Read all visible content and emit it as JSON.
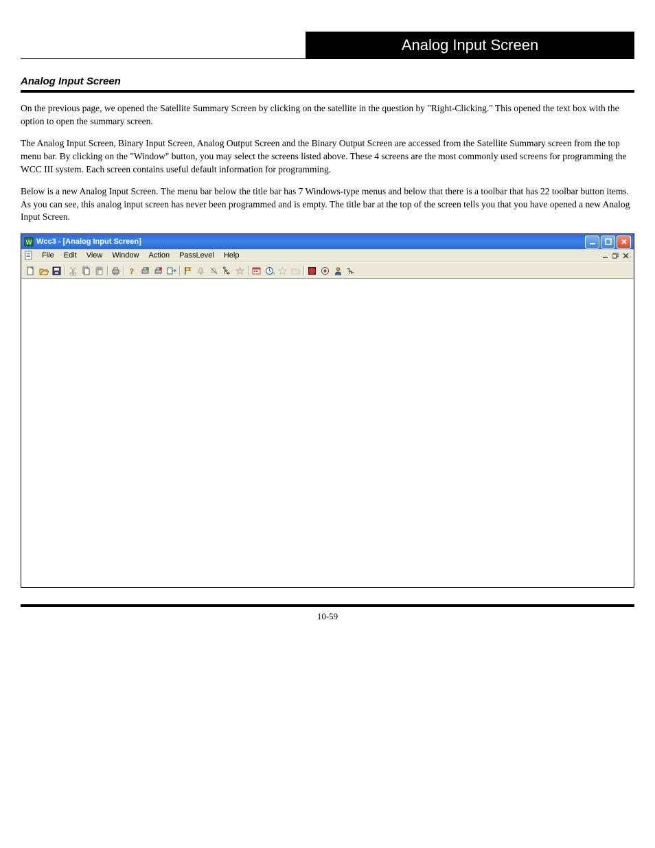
{
  "header": {
    "black_label": "Analog Input Screen"
  },
  "section_title": "Analog Input Screen",
  "paragraphs": {
    "p1": "On the previous page, we opened the Satellite Summary Screen by clicking on the satellite in the question by \"Right-Clicking.\" This opened the text box with the option to open the summary screen.",
    "p2": "The Analog Input Screen, Binary Input Screen, Analog Output Screen and the Binary Output Screen are accessed from the Satellite Summary screen from the top menu bar. By clicking on the \"Window\" button, you may select the screens listed above. These 4 screens are the most commonly used screens for programming the WCC III system. Each screen contains useful default information for programming.",
    "p3": "Below is a new Analog Input Screen. The menu bar below the title bar has 7 Windows-type menus and below that there is a toolbar that has 22 toolbar button items. As you can see, this analog input screen has never been programmed and is empty. The title bar at the top of the screen tells you that you have opened a new Analog Input Screen."
  },
  "window": {
    "title": "Wcc3 - [Analog Input Screen]",
    "buttons": {
      "min": "_",
      "max": "❐",
      "close": "✕"
    },
    "menu": [
      "File",
      "Edit",
      "View",
      "Window",
      "Action",
      "PassLevel",
      "Help"
    ],
    "mdi": {
      "min": "_",
      "max": "❐",
      "close": "✕"
    },
    "toolbar": [
      "new",
      "open",
      "save",
      "sep",
      "cut",
      "copy",
      "paste",
      "sep",
      "print",
      "sep",
      "help-q",
      "send-green",
      "send-red",
      "send-blue",
      "sep",
      "flag",
      "bell",
      "mute",
      "tree",
      "star",
      "sep",
      "calendar",
      "clock",
      "star2",
      "folder",
      "sep",
      "stop",
      "record",
      "person",
      "list"
    ]
  },
  "page_number": "10-59"
}
